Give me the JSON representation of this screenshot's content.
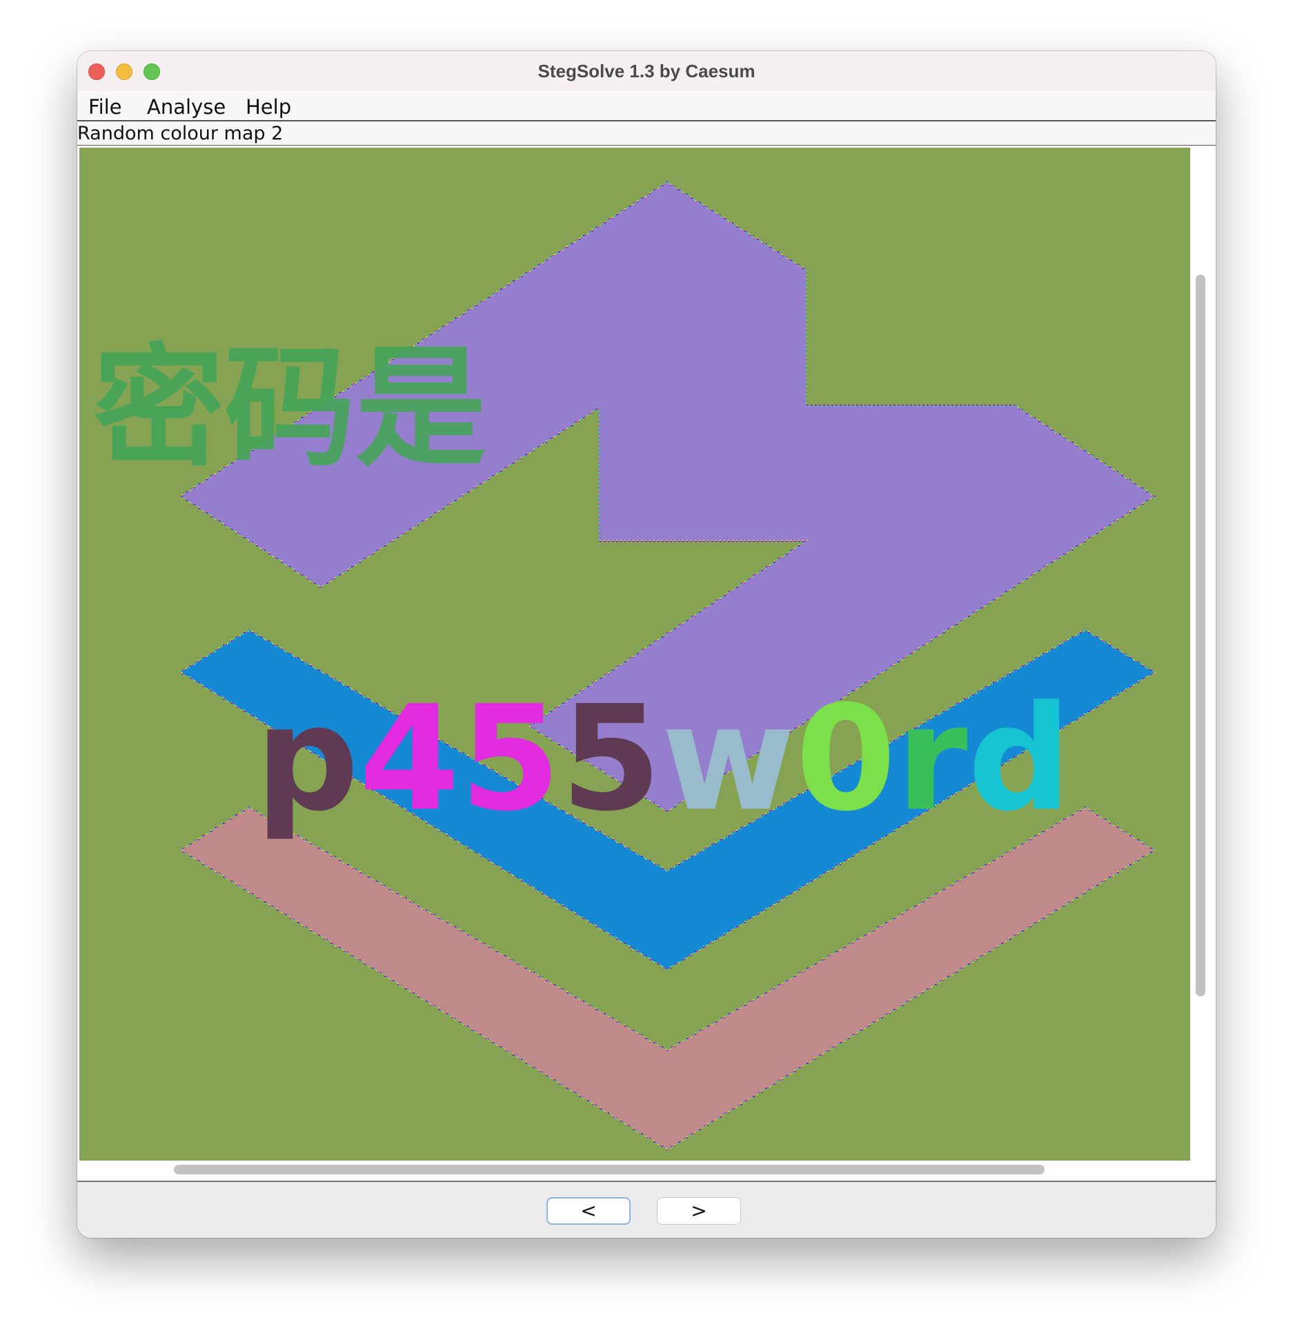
{
  "window": {
    "title": "StegSolve 1.3 by Caesum"
  },
  "menu": {
    "items": [
      "File",
      "Analyse",
      "Help"
    ]
  },
  "status": {
    "plane_label": "Random colour map 2"
  },
  "image": {
    "hidden_text_cn": "密码是",
    "hidden_text_en": "p455w0rd",
    "colors": {
      "background": "#85a353",
      "top_shape": "#967ecf",
      "middle_chevron": "#1589d4",
      "bottom_chevron": "#c08a8b"
    }
  },
  "buttons": {
    "prev_label": "<",
    "next_label": ">"
  }
}
